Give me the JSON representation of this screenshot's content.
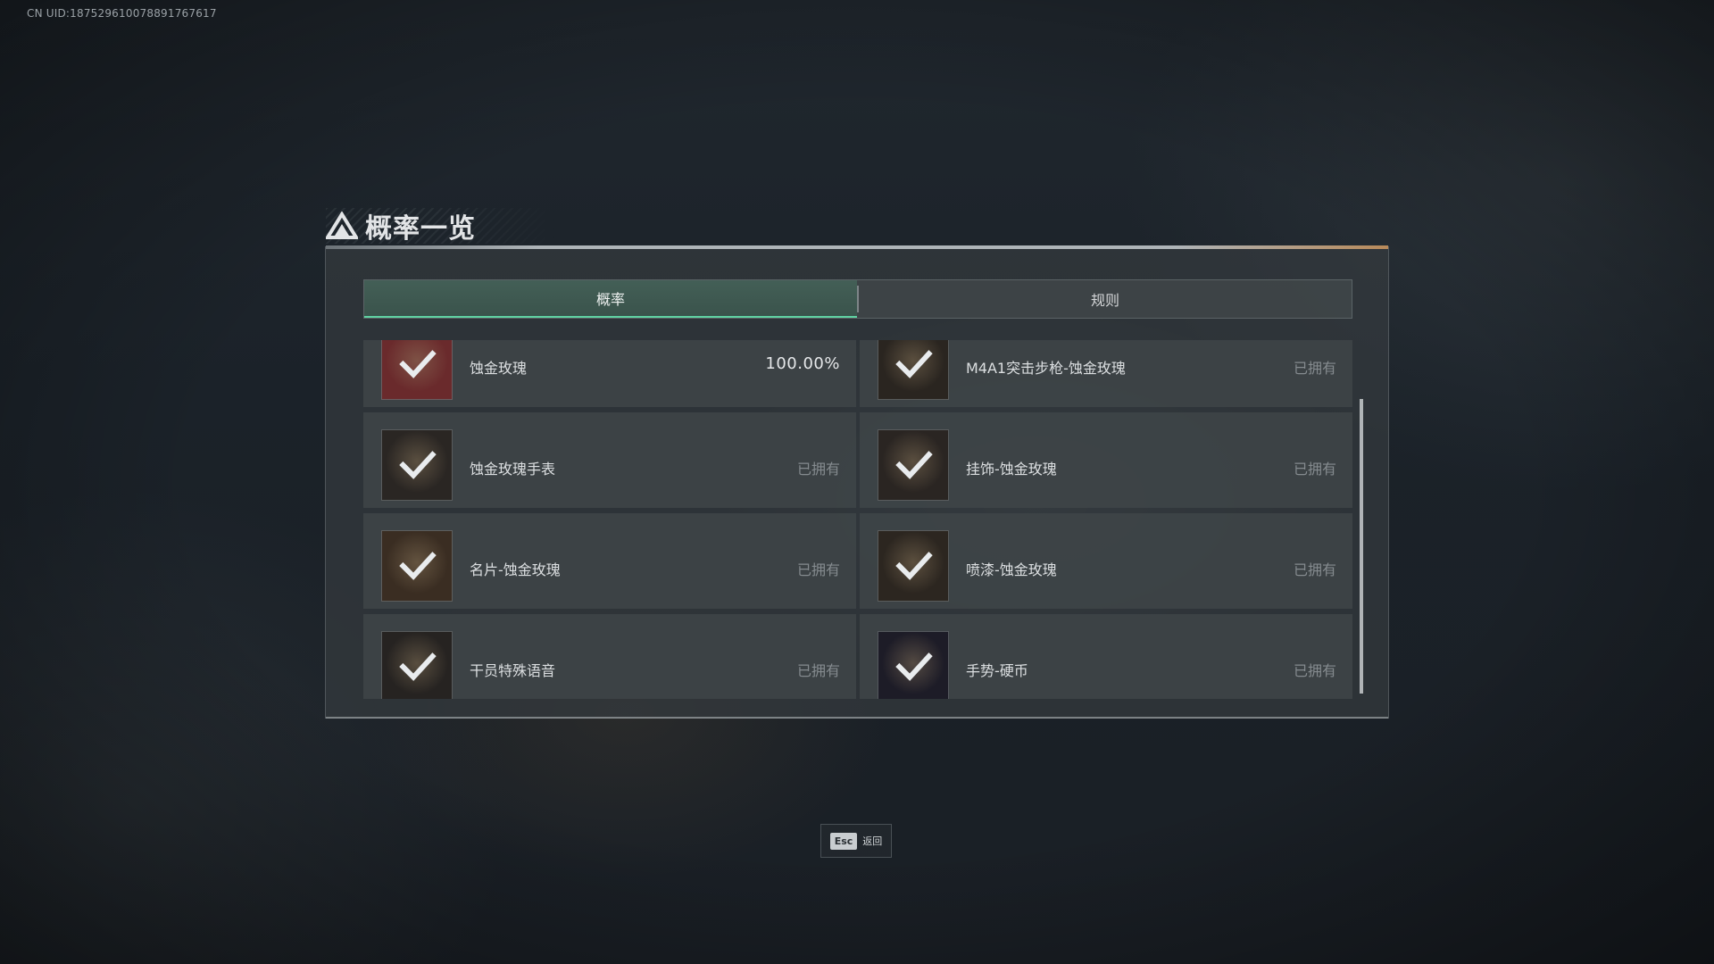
{
  "uid_text": "CN UID:187529610078891767617",
  "dialog": {
    "title": "概率一览",
    "tabs": [
      {
        "label": "概率",
        "active": true
      },
      {
        "label": "规则",
        "active": false
      }
    ]
  },
  "items": [
    {
      "name": "蚀金玫瑰",
      "status": "100.00%",
      "icon": "operator-skin-icon",
      "thumb_color": "#6a2a2c"
    },
    {
      "name": "M4A1突击步枪-蚀金玫瑰",
      "status": "已拥有",
      "icon": "rifle-skin-icon",
      "thumb_color": "#2a2520"
    },
    {
      "name": "蚀金玫瑰手表",
      "status": "已拥有",
      "icon": "watch-icon",
      "thumb_color": "#2a2623"
    },
    {
      "name": "挂饰-蚀金玫瑰",
      "status": "已拥有",
      "icon": "charm-icon",
      "thumb_color": "#2a2522"
    },
    {
      "name": "名片-蚀金玫瑰",
      "status": "已拥有",
      "icon": "name-card-icon",
      "thumb_color": "#3a2d22"
    },
    {
      "name": "喷漆-蚀金玫瑰",
      "status": "已拥有",
      "icon": "spray-icon",
      "thumb_color": "#2c2620"
    },
    {
      "name": "干员特殊语音",
      "status": "已拥有",
      "icon": "voice-line-icon",
      "thumb_color": "#262321"
    },
    {
      "name": "手势-硬币",
      "status": "已拥有",
      "icon": "gesture-icon",
      "thumb_color": "#1d1c27"
    }
  ],
  "footer": {
    "esc_key": "Esc",
    "back_label": "返回"
  }
}
